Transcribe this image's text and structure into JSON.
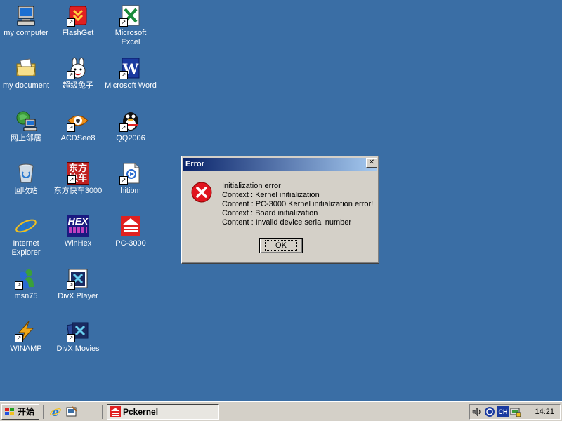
{
  "desktop": {
    "icons": [
      {
        "label": "my computer"
      },
      {
        "label": "FlashGet"
      },
      {
        "label": "Microsoft Excel"
      },
      {
        "label": "my document"
      },
      {
        "label": "超级兔子"
      },
      {
        "label": "Microsoft Word"
      },
      {
        "label": "网上邻居"
      },
      {
        "label": "ACDSee8"
      },
      {
        "label": "QQ2006"
      },
      {
        "label": "回收站"
      },
      {
        "label": "东方快车3000"
      },
      {
        "label": "hitibm"
      },
      {
        "label": "Internet Explorer"
      },
      {
        "label": "WinHex"
      },
      {
        "label": "PC-3000"
      },
      {
        "label": "msn75"
      },
      {
        "label": "DivX Player"
      },
      {
        "label": "WINAMP"
      },
      {
        "label": "DivX Movies"
      }
    ],
    "icon_glyphs": {
      "dongfang": "东方快车",
      "winhex": "HEX"
    }
  },
  "dialog": {
    "title": "Error",
    "close_glyph": "✕",
    "lines": [
      "Initialization error",
      "Context : Kernel initialization",
      "Content : PC-3000 Kernel initialization error!",
      "Context : Board initialization",
      "Content : Invalid device serial number"
    ],
    "ok_label": "OK",
    "error_color": "#e0141e"
  },
  "taskbar": {
    "start_label": "开始",
    "task_label": "Pckernel",
    "tray": {
      "lang": "CH",
      "clock": "14:21"
    }
  },
  "colors": {
    "desktop": "#3a6ea5",
    "title_start": "#0a246a",
    "title_end": "#a6caf0",
    "face": "#d4d0c8"
  }
}
